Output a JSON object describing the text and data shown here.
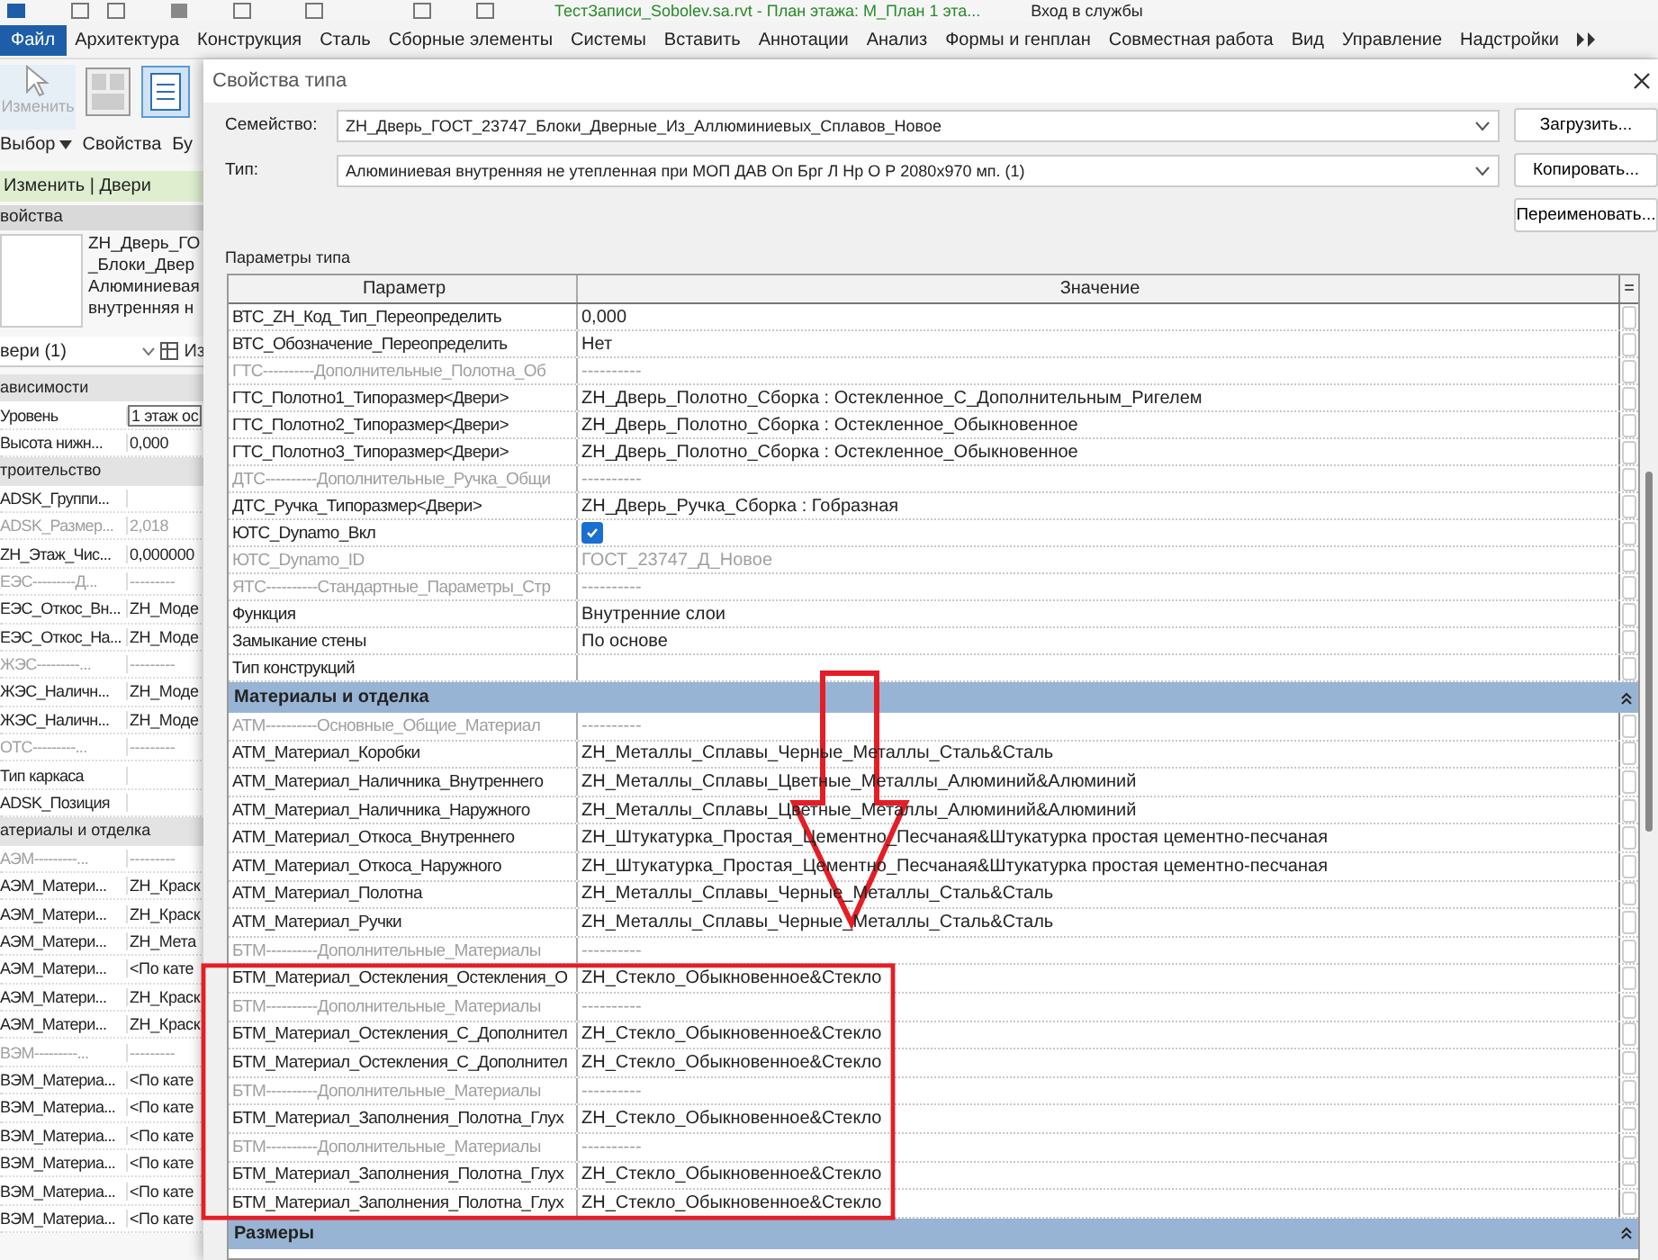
{
  "title_bar": {
    "document": "ТестЗаписи_Sobolev.sa.rvt - План этажа: М_План 1 эта...",
    "sign_in": "Вход в службы"
  },
  "menu": [
    {
      "label": "Файл",
      "selected": true
    },
    {
      "label": "Архитектура",
      "selected": false
    },
    {
      "label": "Конструкция",
      "selected": false
    },
    {
      "label": "Сталь",
      "selected": false
    },
    {
      "label": "Сборные элементы",
      "selected": false
    },
    {
      "label": "Системы",
      "selected": false
    },
    {
      "label": "Вставить",
      "selected": false
    },
    {
      "label": "Аннотации",
      "selected": false
    },
    {
      "label": "Анализ",
      "selected": false
    },
    {
      "label": "Формы и генплан",
      "selected": false
    },
    {
      "label": "Совместная работа",
      "selected": false
    },
    {
      "label": "Вид",
      "selected": false
    },
    {
      "label": "Управление",
      "selected": false
    },
    {
      "label": "Надстройки",
      "selected": false
    }
  ],
  "ribbon": {
    "modify": {
      "label": "Изменить",
      "disabled": true
    },
    "select": "Выбор",
    "properties": "Свойства",
    "cut_label": "Бу",
    "context_tab": "Изменить | Двери"
  },
  "properties_panel": {
    "title": "войства",
    "type_lines": [
      "ZH_Дверь_ГО",
      "_Блоки_Двер",
      "Алюминиевая",
      "внутренняя н"
    ],
    "selector": "вери (1)",
    "edit_type": "Из",
    "rows": [
      {
        "kind": "section",
        "name": "ависимости"
      },
      {
        "kind": "input",
        "name": "Уровень",
        "value": "1 этаж ос",
        "muted": false
      },
      {
        "kind": "param",
        "name": "Высота нижн...",
        "value": "0,000",
        "muted": false
      },
      {
        "kind": "section",
        "name": "троительство"
      },
      {
        "kind": "param",
        "name": "ADSK_Группи...",
        "value": "",
        "muted": false
      },
      {
        "kind": "param",
        "name": "ADSK_Размер...",
        "value": "2,018",
        "muted": true
      },
      {
        "kind": "param",
        "name": "ZH_Этаж_Чис...",
        "value": "0,000000",
        "muted": false
      },
      {
        "kind": "param",
        "name": "ЕЭС---------Д...",
        "value": "---------",
        "muted": true
      },
      {
        "kind": "param",
        "name": "ЕЭС_Откос_Вн...",
        "value": "ZH_Моде",
        "muted": false
      },
      {
        "kind": "param",
        "name": "ЕЭС_Откос_На...",
        "value": "ZH_Моде",
        "muted": false
      },
      {
        "kind": "param",
        "name": "ЖЭС---------...",
        "value": "---------",
        "muted": true
      },
      {
        "kind": "param",
        "name": "ЖЭС_Наличн...",
        "value": "ZH_Моде",
        "muted": false
      },
      {
        "kind": "param",
        "name": "ЖЭС_Наличн...",
        "value": "ZH_Моде",
        "muted": false
      },
      {
        "kind": "param",
        "name": "ОТС---------...",
        "value": "---------",
        "muted": true
      },
      {
        "kind": "param",
        "name": "Тип каркаса",
        "value": "",
        "muted": false
      },
      {
        "kind": "param",
        "name": "ADSK_Позиция",
        "value": "",
        "muted": false
      },
      {
        "kind": "section",
        "name": "атериалы и отделка"
      },
      {
        "kind": "param",
        "name": "АЭМ---------...",
        "value": "---------",
        "muted": true
      },
      {
        "kind": "param",
        "name": "АЭМ_Матери...",
        "value": "ZH_Краск",
        "muted": false
      },
      {
        "kind": "param",
        "name": "АЭМ_Матери...",
        "value": "ZH_Краск",
        "muted": false
      },
      {
        "kind": "param",
        "name": "АЭМ_Матери...",
        "value": "ZH_Мета",
        "muted": false
      },
      {
        "kind": "param",
        "name": "АЭМ_Матери...",
        "value": "<По кате",
        "muted": false
      },
      {
        "kind": "param",
        "name": "АЭМ_Матери...",
        "value": "ZH_Краск",
        "muted": false
      },
      {
        "kind": "param",
        "name": "АЭМ_Матери...",
        "value": "ZH_Краск",
        "muted": false
      },
      {
        "kind": "param",
        "name": "ВЭМ---------...",
        "value": "---------",
        "muted": true
      },
      {
        "kind": "param",
        "name": "ВЭМ_Материа...",
        "value": "<По кате",
        "muted": false
      },
      {
        "kind": "param",
        "name": "ВЭМ_Материа...",
        "value": "<По кате",
        "muted": false
      },
      {
        "kind": "param",
        "name": "ВЭМ_Материа...",
        "value": "<По кате",
        "muted": false
      },
      {
        "kind": "param",
        "name": "ВЭМ_Материа...",
        "value": "<По кате",
        "muted": false
      },
      {
        "kind": "param",
        "name": "ВЭМ_Материа...",
        "value": "<По кате",
        "muted": false
      },
      {
        "kind": "param",
        "name": "ВЭМ_Материа...",
        "value": "<По кате",
        "muted": false
      }
    ]
  },
  "dialog": {
    "title": "Свойства типа",
    "family": {
      "label": "Семейство:",
      "value": "ZH_Дверь_ГОСТ_23747_Блоки_Дверные_Из_Аллюминиевых_Сплавов_Новое",
      "button": "Загрузить..."
    },
    "type": {
      "label": "Тип:",
      "value": "Алюминиевая внутренняя не утепленная при МОП ДАВ Оп Брг Л Нр О Р 2080х970 мп. (1)",
      "button": "Копировать..."
    },
    "rename_button": "Переименовать...",
    "params_label": "Параметры типа",
    "table": {
      "columns": [
        "Параметр",
        "Значение",
        "="
      ],
      "groups": [
        {
          "rows": [
            {
              "kind": "text",
              "name": "ВТС_ZH_Код_Тип_Переопределить",
              "value": "0,000",
              "muted": false
            },
            {
              "kind": "text",
              "name": "ВТС_Обозначение_Переопределить",
              "value": "Нет",
              "muted": false
            },
            {
              "kind": "text",
              "name": "ГТС----------Дополнительные_Полотна_Об",
              "value": "----------",
              "muted": true
            },
            {
              "kind": "text",
              "name": "ГТС_Полотно1_Типоразмер<Двери>",
              "value": "ZH_Дверь_Полотно_Сборка : Остекленное_С_Дополнительным_Ригелем",
              "muted": false
            },
            {
              "kind": "text",
              "name": "ГТС_Полотно2_Типоразмер<Двери>",
              "value": "ZH_Дверь_Полотно_Сборка : Остекленное_Обыкновенное",
              "muted": false
            },
            {
              "kind": "text",
              "name": "ГТС_Полотно3_Типоразмер<Двери>",
              "value": "ZH_Дверь_Полотно_Сборка : Остекленное_Обыкновенное",
              "muted": false
            },
            {
              "kind": "text",
              "name": "ДТС----------Дополнительные_Ручка_Общи",
              "value": "----------",
              "muted": true
            },
            {
              "kind": "text",
              "name": "ДТС_Ручка_Типоразмер<Двери>",
              "value": "ZH_Дверь_Ручка_Сборка : Гобразная",
              "muted": false
            },
            {
              "kind": "checkbox",
              "name": "ЮТС_Dynamo_Вкл",
              "checked": true,
              "muted": false
            },
            {
              "kind": "text",
              "name": "ЮТС_Dynamo_ID",
              "value": "ГОСТ_23747_Д_Новое",
              "muted": true
            },
            {
              "kind": "text",
              "name": "ЯТС----------Стандартные_Параметры_Стр",
              "value": "----------",
              "muted": true
            },
            {
              "kind": "text",
              "name": "Функция",
              "value": "Внутренние слои",
              "muted": false
            },
            {
              "kind": "text",
              "name": "Замыкание стены",
              "value": "По основе",
              "muted": false
            },
            {
              "kind": "text",
              "name": "Тип конструкций",
              "value": "",
              "muted": false
            }
          ]
        },
        {
          "title": "Материалы и отделка",
          "rows": [
            {
              "kind": "text",
              "name": "АТМ----------Основные_Общие_Материал",
              "value": "----------",
              "muted": true
            },
            {
              "kind": "text",
              "name": "АТМ_Материал_Коробки",
              "value": "ZH_Металлы_Сплавы_Черные_Металлы_Сталь&Сталь",
              "muted": false
            },
            {
              "kind": "text",
              "name": "АТМ_Материал_Наличника_Внутреннего",
              "value": "ZH_Металлы_Сплавы_Цветные_Металлы_Алюминий&Алюминий",
              "muted": false
            },
            {
              "kind": "text",
              "name": "АТМ_Материал_Наличника_Наружного",
              "value": "ZH_Металлы_Сплавы_Цветные_Металлы_Алюминий&Алюминий",
              "muted": false
            },
            {
              "kind": "text",
              "name": "АТМ_Материал_Откоса_Внутреннего",
              "value": "ZH_Штукатурка_Простая_Цементно_Песчаная&Штукатурка простая цементно-песчаная",
              "muted": false
            },
            {
              "kind": "text",
              "name": "АТМ_Материал_Откоса_Наружного",
              "value": "ZH_Штукатурка_Простая_Цементно_Песчаная&Штукатурка простая цементно-песчаная",
              "muted": false
            },
            {
              "kind": "text",
              "name": "АТМ_Материал_Полотна",
              "value": "ZH_Металлы_Сплавы_Черные_Металлы_Сталь&Сталь",
              "muted": false
            },
            {
              "kind": "text",
              "name": "АТМ_Материал_Ручки",
              "value": "ZH_Металлы_Сплавы_Черные_Металлы_Сталь&Сталь",
              "muted": false
            },
            {
              "kind": "text",
              "name": "БТМ----------Дополнительные_Материалы",
              "value": "----------",
              "muted": true
            },
            {
              "kind": "text",
              "name": "БТМ_Материал_Остекления_Остекления_О",
              "value": "ZH_Стекло_Обыкновенное&Стекло",
              "muted": false
            },
            {
              "kind": "text",
              "name": "БТМ----------Дополнительные_Материалы",
              "value": "----------",
              "muted": true
            },
            {
              "kind": "text",
              "name": "БТМ_Материал_Остекления_С_Дополнител",
              "value": "ZH_Стекло_Обыкновенное&Стекло",
              "muted": false
            },
            {
              "kind": "text",
              "name": "БТМ_Материал_Остекления_С_Дополнител",
              "value": "ZH_Стекло_Обыкновенное&Стекло",
              "muted": false
            },
            {
              "kind": "text",
              "name": "БТМ----------Дополнительные_Материалы",
              "value": "----------",
              "muted": true
            },
            {
              "kind": "text",
              "name": "БТМ_Материал_Заполнения_Полотна_Глух",
              "value": "ZH_Стекло_Обыкновенное&Стекло",
              "muted": false
            },
            {
              "kind": "text",
              "name": "БТМ----------Дополнительные_Материалы",
              "value": "----------",
              "muted": true
            },
            {
              "kind": "text",
              "name": "БТМ_Материал_Заполнения_Полотна_Глух",
              "value": "ZH_Стекло_Обыкновенное&Стекло",
              "muted": false
            },
            {
              "kind": "text",
              "name": "БТМ_Материал_Заполнения_Полотна_Глух",
              "value": "ZH_Стекло_Обыкновенное&Стекло",
              "muted": false
            }
          ]
        },
        {
          "title": "Размеры"
        }
      ]
    }
  }
}
